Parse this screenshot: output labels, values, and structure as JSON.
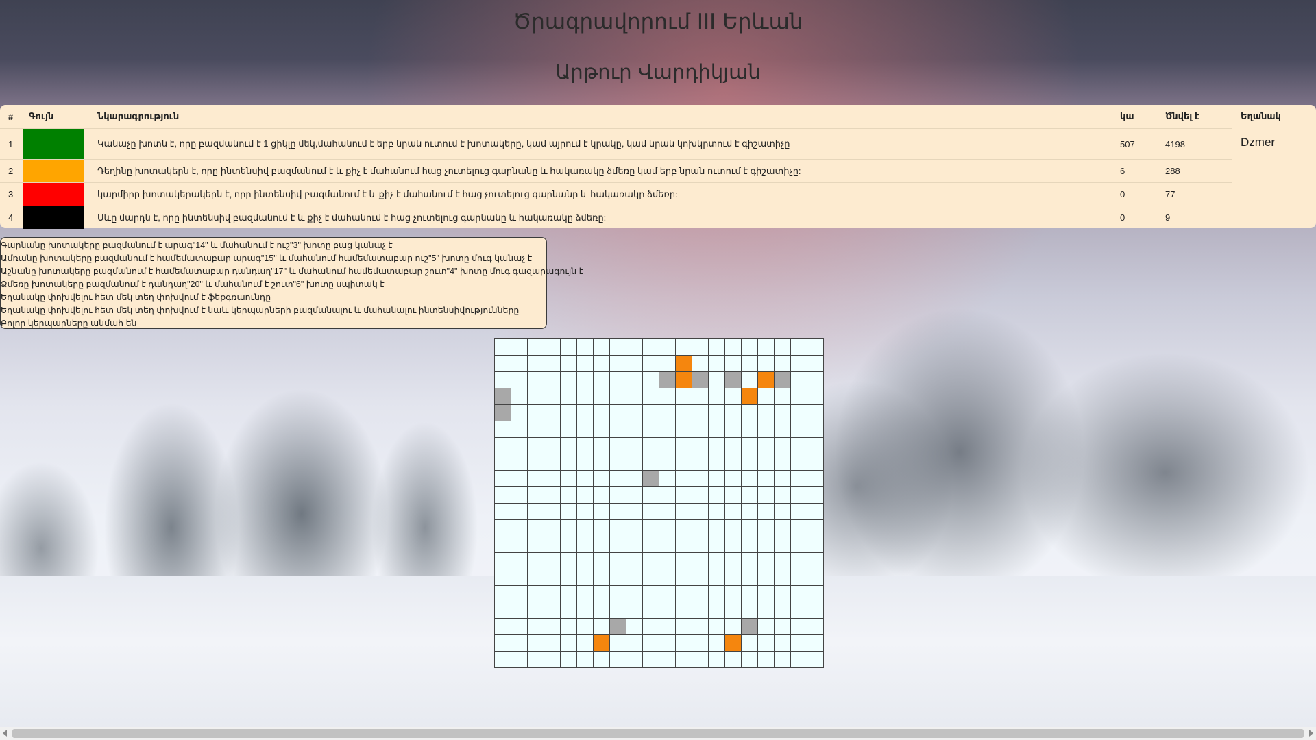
{
  "header": {
    "title": "Ծրագրավորում III Երևան",
    "subtitle": "Արթուր Վարդիկյան"
  },
  "table": {
    "headers": {
      "num": "#",
      "color": "Գույն",
      "desc": "Նկարագրություն",
      "count": "կա",
      "born": "Ծնվել է",
      "weather": "Եղանակ"
    },
    "rows": [
      {
        "num": "1",
        "color": "#008000",
        "desc": "Կանաչը խոտն է, որը բազմանում է 1 ցիկլը մեկ,մահանում է երբ նրան ուտում է խոտակերը, կամ այրում է կրակը, կամ նրան կոխկրտում է գիշատիչը",
        "count": "507",
        "born": "4198"
      },
      {
        "num": "2",
        "color": "#ffa500",
        "desc": "Դեղինը խոտակերն է, որը ինտենսիվ բազմանում է և քիչ է մահանում հաց չուտելուց գարնանը և հակառակը ձմեռը կամ երբ նրան ուտում է գիշատիչը:",
        "count": "6",
        "born": "288"
      },
      {
        "num": "3",
        "color": "#ff0000",
        "desc": "կարմիրը խոտակերակերն է, որը ինտենսիվ բազմանում է և քիչ է մահանում է հաց չուտելուց գարնանը և հակառակը ձմեռը:",
        "count": "0",
        "born": "77"
      },
      {
        "num": "4",
        "color": "#000000",
        "desc": "Սևը մարդն է, որը ինտենսիվ բազմանում է և քիչ է մահանում է հաց չուտելուց գարնանը և հակառակը ձմեռը:",
        "count": "0",
        "born": "9"
      }
    ],
    "weather_value": "Dzmer"
  },
  "rules": [
    "Գարնանը խոտակերը բազմանում է արագ\"14\" և մահանում է ուշ\"3\" խոտը բաց կանաչ է",
    "Ամռանը խոտակերը բազմանում է համեմատաբար արագ\"15\" և մահանում համեմատաբար ուշ\"5\" խոտը մուգ կանաչ է",
    "Աշնանը խոտակերը բազմանում է համեմատաբար դանդաղ\"17\" և մահանում համեմատաբար շուտ\"4\" խոտը մուգ գազարագույն է",
    "Ձմեռը խոտակերը բազմանում է դանդաղ\"20\" և մահանում է շուտ\"6\" խոտը սպիտակ է",
    "Եղանակը փոխվելու հետ մեկ տեղ փոխվում է ֆեքգռաունդը",
    "Եղանակը փոխվելու հետ մեկ տեղ փոխվում է նաև կերպարների բազմանալու և մահանալու ինտենսիվությունները",
    "Բոլոր կերպարները անմահ են"
  ],
  "grid": {
    "size": 20,
    "empty_color": "#f0ffff",
    "orange_color": "#f5860e",
    "gray_color": "#a8a8a8",
    "orange_cells": [
      [
        1,
        11
      ],
      [
        2,
        11
      ],
      [
        2,
        16
      ],
      [
        3,
        15
      ],
      [
        18,
        6
      ],
      [
        18,
        14
      ]
    ],
    "gray_cells": [
      [
        2,
        10
      ],
      [
        2,
        12
      ],
      [
        2,
        14
      ],
      [
        2,
        17
      ],
      [
        3,
        0
      ],
      [
        4,
        0
      ],
      [
        8,
        9
      ],
      [
        17,
        7
      ],
      [
        17,
        15
      ]
    ]
  }
}
